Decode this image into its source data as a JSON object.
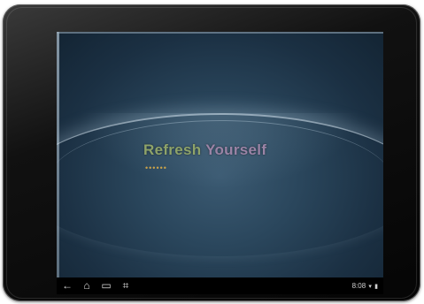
{
  "screen": {
    "headline": {
      "word1": "Refresh",
      "word2": "Yourself"
    },
    "loading_dots": "••••••"
  },
  "navbar": {
    "icons": [
      "back-icon",
      "home-icon",
      "recent-apps-icon",
      "screenshot-icon"
    ],
    "back_glyph": "←",
    "home_glyph": "⌂",
    "recent_glyph": "▭",
    "screenshot_glyph": "⌗",
    "time": "8:08",
    "wifi_glyph": "▾",
    "battery_glyph": "▮"
  },
  "colors": {
    "bezel": "#0a0a0a",
    "screen_bg": "#2a465c",
    "headline_word1": "#8ea36a",
    "headline_word2": "#9b84a6",
    "dots": "#c9a24a",
    "navbar": "#000000"
  }
}
